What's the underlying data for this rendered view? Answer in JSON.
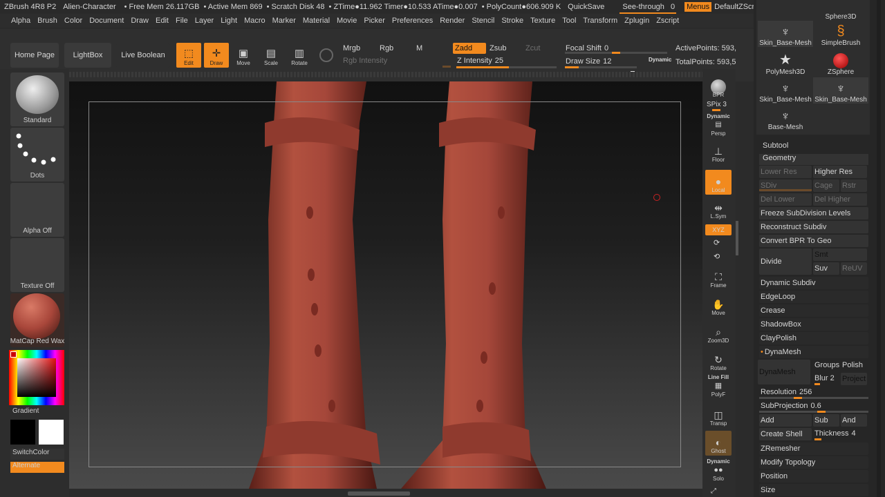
{
  "titlebar": {
    "app": "ZBrush 4R8 P2",
    "project": "Alien-Character",
    "free_mem": "• Free Mem 26.117GB",
    "active_mem": "• Active Mem 869",
    "scratch": "• Scratch Disk 48",
    "ztime": "• ZTime●11.962 Timer●10.533 ATime●0.007",
    "polycount": "• PolyCount●606.909 K",
    "quicksave": "QuickSave",
    "seethrough": "See-through",
    "seethrough_value": "0",
    "menus": "Menus",
    "zscript": "DefaultZScript"
  },
  "menubar": [
    "Alpha",
    "Brush",
    "Color",
    "Document",
    "Draw",
    "Edit",
    "File",
    "Layer",
    "Light",
    "Macro",
    "Marker",
    "Material",
    "Movie",
    "Picker",
    "Preferences",
    "Render",
    "Stencil",
    "Stroke",
    "Texture",
    "Tool",
    "Transform",
    "Zplugin",
    "Zscript"
  ],
  "shelf": {
    "home": "Home Page",
    "lightbox": "LightBox",
    "liveboolean": "Live Boolean",
    "edit": "Edit",
    "draw": "Draw",
    "move": "Move",
    "scale": "Scale",
    "rotate": "Rotate",
    "mrgb": "Mrgb",
    "rgb": "Rgb",
    "m": "M",
    "rgb_intensity": "Rgb Intensity",
    "zadd": "Zadd",
    "zsub": "Zsub",
    "zcut": "Zcut",
    "z_intensity_label": "Z Intensity",
    "z_intensity": "25",
    "focal_label": "Focal Shift",
    "focal": "0",
    "drawsize_label": "Draw Size",
    "drawsize": "12",
    "dynamic": "Dynamic",
    "active_points": "ActivePoints: 593,",
    "total_points": "TotalPoints: 593,5"
  },
  "left": {
    "brush": "Standard",
    "stroke": "Dots",
    "alpha": "Alpha Off",
    "texture": "Texture Off",
    "material": "MatCap Red Wax",
    "gradient": "Gradient",
    "switchcolor": "SwitchColor",
    "alternate": "Alternate"
  },
  "righttools": {
    "bpr": "BPR",
    "spix": "SPix 3",
    "dynamic": "Dynamic",
    "persp": "Persp",
    "floor": "Floor",
    "local": "Local",
    "lsym": "L.Sym",
    "xyz": "XYZ",
    "frame": "Frame",
    "move": "Move",
    "zoom": "Zoom3D",
    "rotate": "Rotate",
    "linefill": "Line Fill",
    "polyf": "PolyF",
    "transp": "Transp",
    "ghost": "Ghost",
    "dynamic2": "Dynamic",
    "solo": "Solo"
  },
  "tools": {
    "t1": "Skin_Base-Mesh",
    "t2": "SimpleBrush",
    "t2top": "Sphere3D",
    "t3": "PolyMesh3D",
    "t4": "ZSphere",
    "t5": "Skin_Base-Mesh",
    "t6": "Skin_Base-Mesh",
    "t7": "Base-Mesh"
  },
  "panel": {
    "subtool": "Subtool",
    "geometry": "Geometry",
    "lower_res": "Lower Res",
    "higher_res": "Higher Res",
    "sdiv": "SDiv",
    "cage": "Cage",
    "rstr": "Rstr",
    "del_lower": "Del Lower",
    "del_higher": "Del Higher",
    "freeze": "Freeze SubDivision Levels",
    "reconstruct": "Reconstruct Subdiv",
    "convert": "Convert BPR To Geo",
    "divide": "Divide",
    "smt": "Smt",
    "suv": "Suv",
    "reuv": "ReUV",
    "dynamic_subdiv": "Dynamic Subdiv",
    "edgeloop": "EdgeLoop",
    "crease": "Crease",
    "shadowbox": "ShadowBox",
    "claypolish": "ClayPolish",
    "dynamesh_head": "DynaMesh",
    "dynamesh": "DynaMesh",
    "groups": "Groups",
    "polish": "Polish",
    "blur": "Blur",
    "blur_value": "2",
    "project": "Project",
    "resolution_label": "Resolution",
    "resolution": "256",
    "subprojection_label": "SubProjection",
    "subprojection": "0.6",
    "add": "Add",
    "sub": "Sub",
    "and": "And",
    "create_shell": "Create Shell",
    "thickness_label": "Thickness",
    "thickness": "4",
    "zremesher": "ZRemesher",
    "modify_topology": "Modify Topology",
    "position": "Position",
    "size": "Size"
  },
  "colors": {
    "accent": "#f28a1e",
    "clay": "#a8463a"
  }
}
